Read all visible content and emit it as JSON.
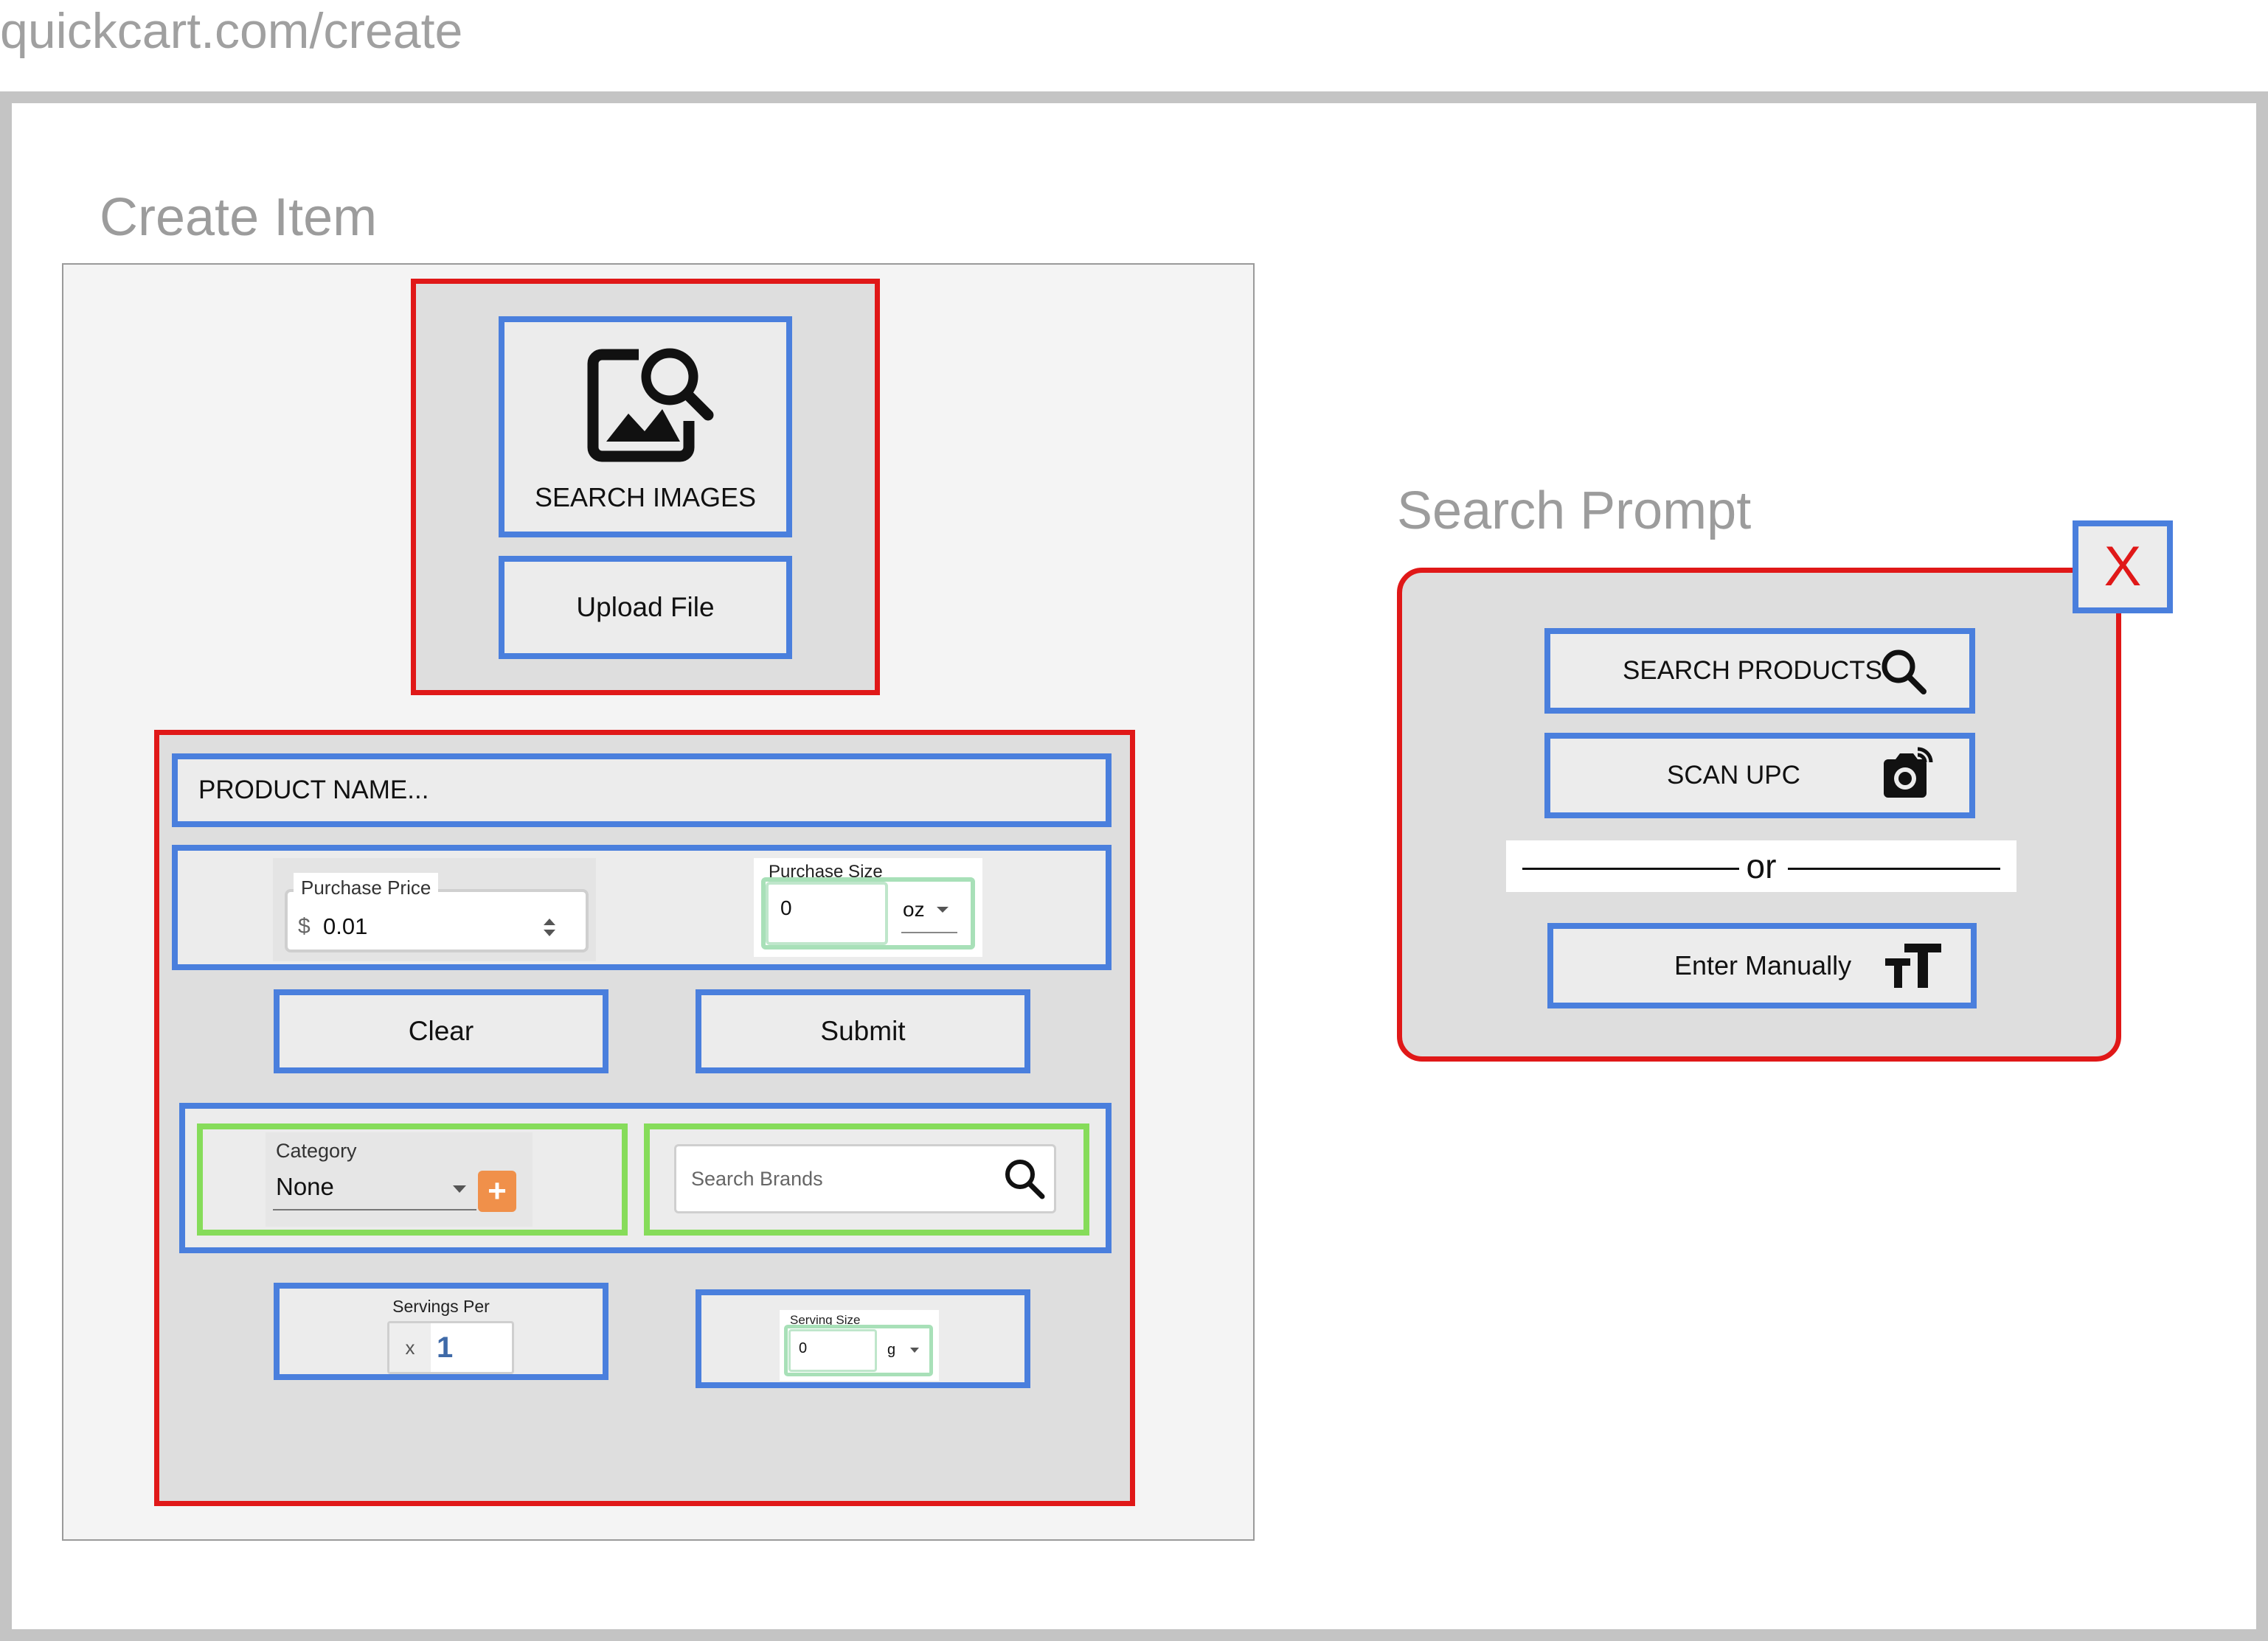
{
  "browser": {
    "url": "quickcart.com/create"
  },
  "create_item": {
    "title": "Create Item",
    "search_images_label": "SEARCH IMAGES",
    "upload_file_label": "Upload File",
    "product_name_placeholder": "PRODUCT NAME...",
    "purchase_price": {
      "label": "Purchase Price",
      "currency": "$",
      "value": "0.01"
    },
    "purchase_size": {
      "label": "Purchase Size",
      "value": "0",
      "unit": "oz"
    },
    "clear_label": "Clear",
    "submit_label": "Submit",
    "category": {
      "label": "Category",
      "value": "None",
      "add_glyph": "+"
    },
    "brand_search": {
      "placeholder": "Search Brands"
    },
    "servings_per": {
      "label": "Servings Per",
      "prefix": "x",
      "value": "1"
    },
    "serving_size": {
      "label": "Serving Size",
      "value": "0",
      "unit": "g"
    }
  },
  "search_prompt": {
    "title": "Search Prompt",
    "close_label": "X",
    "search_products_label": "SEARCH PRODUCTS",
    "scan_upc_label": "SCAN UPC",
    "or_label": "or",
    "enter_manually_label": "Enter Manually"
  },
  "icons": {
    "image-search": "image-search-icon",
    "search": "search-icon",
    "camera": "camera-icon",
    "text-size": "text-size-icon",
    "dropdown": "chevron-down-icon",
    "stepper": "stepper-icon"
  },
  "colors": {
    "outline_blue": "#4a7fdd",
    "outline_red": "#e01818",
    "outline_green": "#86dc5a",
    "add_button": "#f0904a",
    "close_x": "#e01818"
  }
}
